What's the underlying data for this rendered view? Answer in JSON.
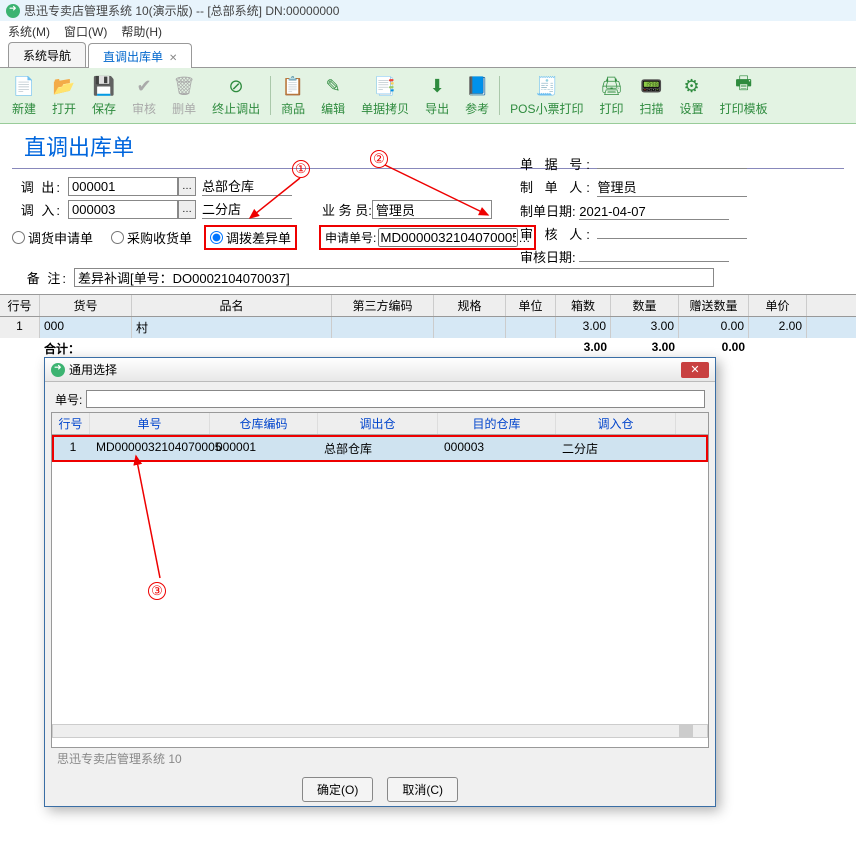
{
  "window": {
    "title": "思迅专卖店管理系统 10(演示版) -- [总部系统] DN:00000000"
  },
  "menu": {
    "system": "系统(M)",
    "window": "窗口(W)",
    "help": "帮助(H)"
  },
  "tabs": {
    "nav": "系统导航",
    "current": "直调出库单"
  },
  "toolbar": {
    "new": "新建",
    "open": "打开",
    "save": "保存",
    "audit": "审核",
    "delete": "删单",
    "stop": "终止调出",
    "product": "商品",
    "edit": "编辑",
    "copy": "单据拷贝",
    "export": "导出",
    "ref": "参考",
    "pos": "POS小票打印",
    "print": "打印",
    "scan": "扫描",
    "settings": "设置",
    "template": "打印模板"
  },
  "form": {
    "title": "直调出库单",
    "out_label": "调   出:",
    "out_code": "000001",
    "out_name": "总部仓库",
    "in_label": "调   入:",
    "in_code": "000003",
    "in_name": "二分店",
    "radio1": "调货申请单",
    "radio2": "采购收货单",
    "radio3": "调拨差异单",
    "apply_label": "申请单号:",
    "apply_value": "MD0000032104070005",
    "biz_label": "业 务 员:",
    "biz_value": "管理员",
    "remark_label": "备    注:",
    "remark_value": "差异补调[单号：DO0002104070037]"
  },
  "right": {
    "doc_label": "单 据 号:",
    "doc_value": "",
    "maker_label": "制 单 人:",
    "maker_value": "管理员",
    "date_label": "制单日期:",
    "date_value": "2021-04-07",
    "auditor_label": "审 核 人:",
    "auditor_value": "",
    "adate_label": "审核日期:",
    "adate_value": ""
  },
  "grid": {
    "headers": {
      "row": "行号",
      "code": "货号",
      "name": "品名",
      "third": "第三方编码",
      "spec": "规格",
      "unit": "单位",
      "box": "箱数",
      "qty": "数量",
      "gift": "赠送数量",
      "price": "单价"
    },
    "row": {
      "no": "1",
      "code": "000",
      "name": "村",
      "box": "3.00",
      "qty": "3.00",
      "gift": "0.00",
      "price": "2.00"
    },
    "total_label": "合计：",
    "t_box": "3.00",
    "t_qty": "3.00",
    "t_gift": "0.00"
  },
  "dialog": {
    "title": "通用选择",
    "search_label": "单号:",
    "headers": {
      "row": "行号",
      "doc": "单号",
      "wh": "仓库编码",
      "out": "调出仓",
      "dest": "目的仓库",
      "in": "调入仓"
    },
    "row": {
      "no": "1",
      "doc": "MD0000032104070005",
      "wh": "000001",
      "out": "总部仓库",
      "dest": "000003",
      "in": "二分店"
    },
    "status": "思迅专卖店管理系统 10",
    "ok": "确定(O)",
    "cancel": "取消(C)"
  },
  "anno": {
    "a1": "①",
    "a2": "②",
    "a3": "③"
  }
}
